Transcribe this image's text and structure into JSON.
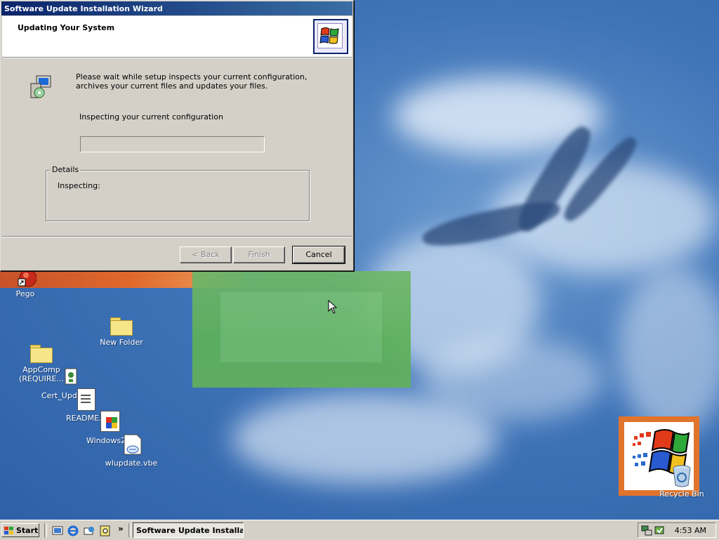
{
  "window": {
    "title": "Software Update Installation Wizard",
    "header_title": "Updating Your System",
    "description": "Please wait while setup inspects your current configuration, archives your current files and updates your files.",
    "status": "Inspecting your current configuration",
    "progress": 0,
    "details_title": "Details",
    "details_text": "Inspecting:",
    "buttons": {
      "back": "< Back",
      "finish": "Finish",
      "cancel": "Cancel"
    }
  },
  "desktop_icons": {
    "pego": "Pego",
    "new_folder": "New Folder",
    "appcomp": "AppComp\n(REQUIRE...",
    "cert_update": "Cert_Upda...",
    "readme": "README.t",
    "windows20": "Windows20...",
    "wlupdate": "wlupdate.vbe",
    "recycle_bin": "Recycle Bin"
  },
  "taskbar": {
    "start_label": "Start",
    "task_button": "Software Update Installa...",
    "chevron": "»",
    "clock": "4:53 AM"
  },
  "icons": {
    "start": "windows-flag-icon",
    "quicklaunch": [
      "show-desktop-icon",
      "internet-explorer-icon",
      "outlook-express-icon",
      "search-icon"
    ]
  }
}
